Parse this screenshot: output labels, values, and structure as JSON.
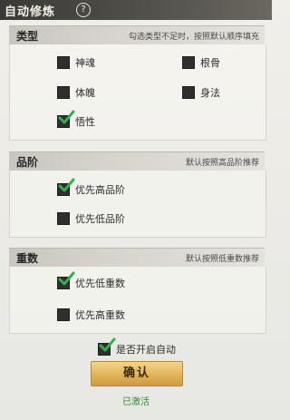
{
  "header": {
    "title": "自动修炼",
    "help_symbol": "?"
  },
  "sections": {
    "type": {
      "title": "类型",
      "hint": "勾选类型不足时，按照默认顺序填充",
      "options": [
        {
          "label": "神魂",
          "checked": false
        },
        {
          "label": "根骨",
          "checked": false
        },
        {
          "label": "体魄",
          "checked": false
        },
        {
          "label": "身法",
          "checked": false
        },
        {
          "label": "悟性",
          "checked": true
        }
      ]
    },
    "grade": {
      "title": "品阶",
      "hint": "默认按照高品阶推荐",
      "options": [
        {
          "label": "优先高品阶",
          "checked": true
        },
        {
          "label": "优先低品阶",
          "checked": false
        }
      ]
    },
    "weight": {
      "title": "重数",
      "hint": "默认按照低重数推荐",
      "options": [
        {
          "label": "优先低重数",
          "checked": true
        },
        {
          "label": "优先高重数",
          "checked": false
        }
      ]
    }
  },
  "auto": {
    "label": "是否开启自动",
    "checked": true
  },
  "confirm_label": "确认",
  "status_text": "已激活",
  "colors": {
    "checkmark": "#2fb24a",
    "status": "#2e8b2e",
    "button": "#e0b55a"
  }
}
